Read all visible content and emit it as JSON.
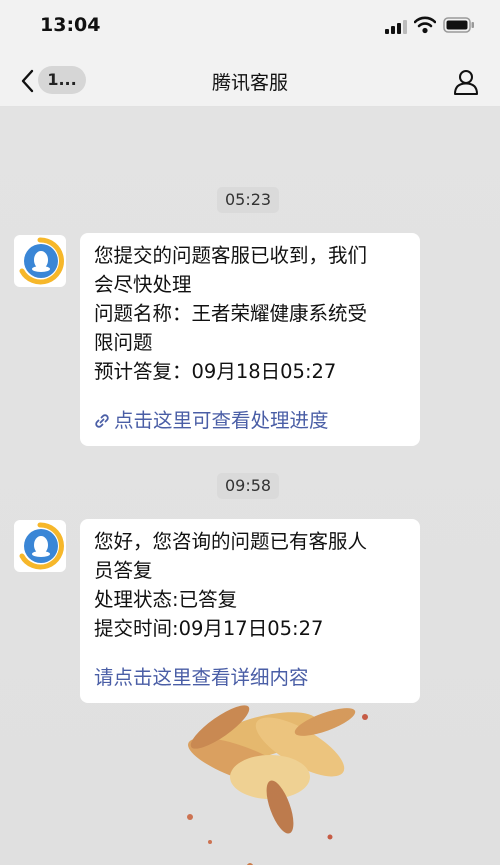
{
  "status_bar": {
    "time": "13:04"
  },
  "nav": {
    "back_label": "1...",
    "title": "腾讯客服"
  },
  "messages": [
    {
      "timestamp": "05:23",
      "lines": [
        "您提交的问题客服已收到，我们",
        "会尽快处理",
        "问题名称：王者荣耀健康系统受",
        "限问题",
        "预计答复：09月18日05:27"
      ],
      "link": "点击这里可查看处理进度"
    },
    {
      "timestamp": "09:58",
      "lines": [
        "您好，您咨询的问题已有客服人",
        "员答复",
        "处理状态:已答复",
        "提交时间:09月17日05:27"
      ],
      "link": "请点击这里查看详细内容"
    }
  ],
  "icons": {
    "back": "chevron-left-icon",
    "profile": "person-icon",
    "avatar": "qq-penguin-icon",
    "link": "link-icon"
  },
  "colors": {
    "link": "#4a5ea6",
    "avatar_blue": "#3a86d6",
    "avatar_yellow": "#f6b72a"
  }
}
